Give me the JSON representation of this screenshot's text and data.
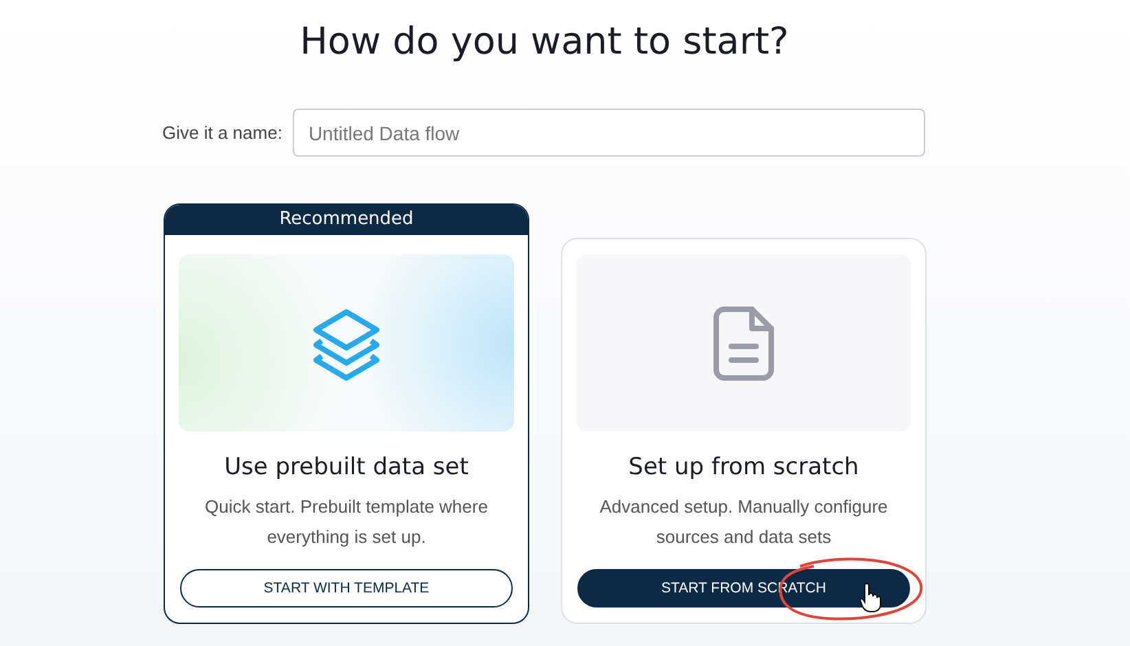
{
  "heading": "How do you want to start?",
  "name_field": {
    "label": "Give it a name:",
    "placeholder": "Untitled Data flow"
  },
  "options": [
    {
      "badge": "Recommended",
      "kind": "layers",
      "title": "Use prebuilt data set",
      "description": "Quick start. Prebuilt template where everything is set up.",
      "button": {
        "label": "START WITH TEMPLATE",
        "kind": "outline"
      }
    },
    {
      "kind": "document",
      "title": "Set up from scratch",
      "description": "Advanced setup. Manually configure sources and data sets",
      "button": {
        "label": "START FROM SCRATCH",
        "kind": "filled"
      },
      "annotated": true
    }
  ]
}
